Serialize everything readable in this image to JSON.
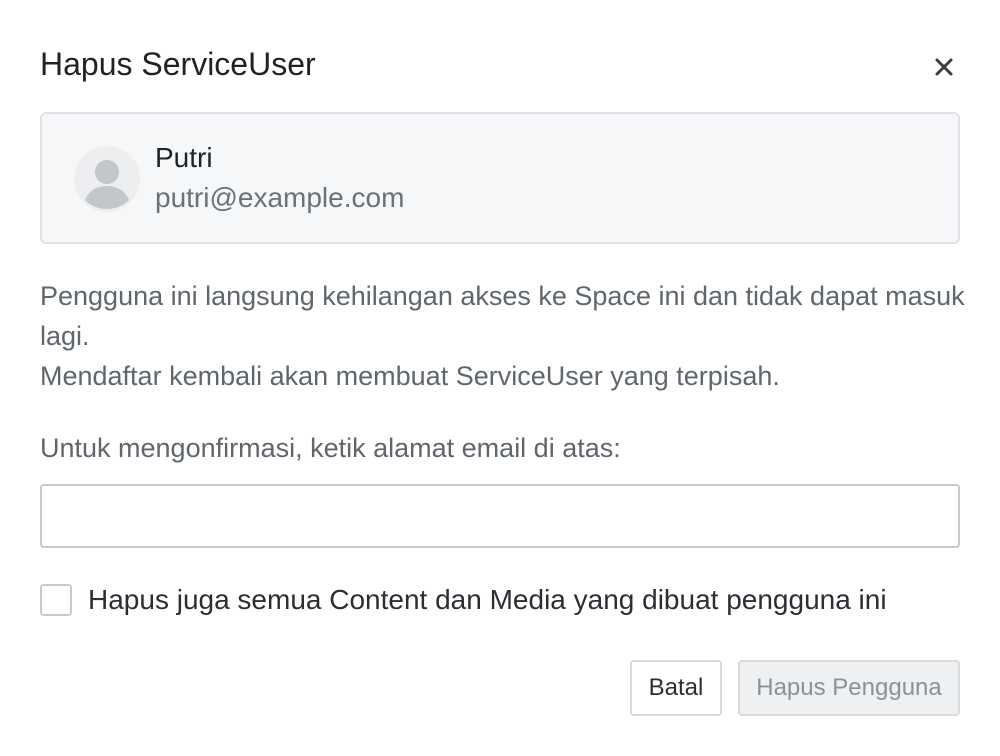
{
  "dialog": {
    "title": "Hapus ServiceUser",
    "close_icon": "close-icon"
  },
  "user": {
    "name": "Putri",
    "email": "putri@example.com",
    "avatar_icon": "user-avatar-icon"
  },
  "description": {
    "line1": "Pengguna ini langsung kehilangan akses ke Space ini dan tidak dapat masuk lagi.",
    "line2": "Mendaftar kembali akan membuat ServiceUser yang terpisah."
  },
  "confirm": {
    "label": "Untuk mengonfirmasi, ketik alamat email di atas:",
    "value": "",
    "placeholder": ""
  },
  "delete_content_checkbox": {
    "label": "Hapus juga semua Content dan Media yang dibuat pengguna ini",
    "checked": false
  },
  "buttons": {
    "cancel_label": "Batal",
    "delete_label": "Hapus Pengguna",
    "delete_disabled": true
  },
  "colors": {
    "card_background": "#f6f7f8",
    "disabled_button_background": "#eef0f2",
    "disabled_button_text": "#8c9197"
  }
}
